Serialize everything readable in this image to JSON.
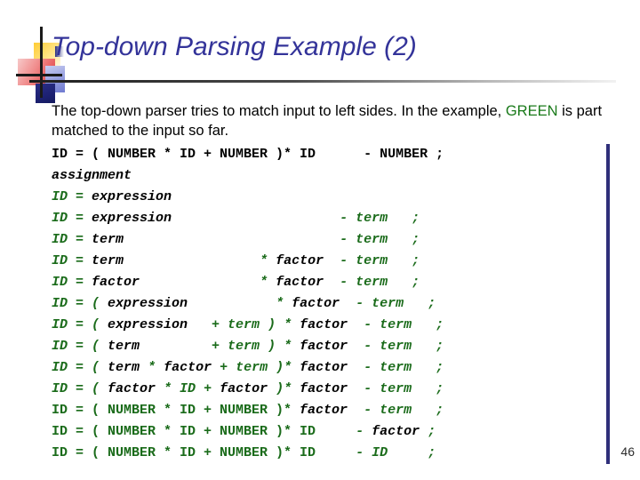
{
  "slide": {
    "title": "Top-down Parsing Example (2)",
    "page_number": "46",
    "accent_color": "#333399",
    "green_color": "#1a6b1a",
    "body": {
      "line1_prefix": "The top-down parser tries to match input to left sides.  In the example, ",
      "green_word": "GREEN",
      "line1_suffix": " is part matched to the input so far."
    }
  },
  "code": {
    "lines": [
      {
        "segments": [
          {
            "text": "ID = ( NUMBER * ID + NUMBER )* ID      ",
            "style": "blk"
          },
          {
            "text": "- NUMBER ;",
            "style": "blk"
          }
        ]
      },
      {
        "segments": [
          {
            "text": "assignment",
            "style": "blki"
          }
        ]
      },
      {
        "segments": [
          {
            "text": "ID = ",
            "style": "grni"
          },
          {
            "text": "expression",
            "style": "blki"
          }
        ]
      },
      {
        "segments": [
          {
            "text": "ID = ",
            "style": "grni"
          },
          {
            "text": "expression",
            "style": "blki"
          },
          {
            "text": "                     ",
            "style": "blki"
          },
          {
            "text": "- term   ;",
            "style": "grni"
          }
        ]
      },
      {
        "segments": [
          {
            "text": "ID = ",
            "style": "grni"
          },
          {
            "text": "term",
            "style": "blki"
          },
          {
            "text": "                           ",
            "style": "blki"
          },
          {
            "text": "- term   ;",
            "style": "grni"
          }
        ]
      },
      {
        "segments": [
          {
            "text": "ID = ",
            "style": "grni"
          },
          {
            "text": "term",
            "style": "blki"
          },
          {
            "text": "                 ",
            "style": "blki"
          },
          {
            "text": "* ",
            "style": "grni"
          },
          {
            "text": "factor",
            "style": "blki"
          },
          {
            "text": "  ",
            "style": "blki"
          },
          {
            "text": "- term   ;",
            "style": "grni"
          }
        ]
      },
      {
        "segments": [
          {
            "text": "ID = ",
            "style": "grni"
          },
          {
            "text": "factor",
            "style": "blki"
          },
          {
            "text": "               ",
            "style": "blki"
          },
          {
            "text": "* ",
            "style": "grni"
          },
          {
            "text": "factor",
            "style": "blki"
          },
          {
            "text": "  ",
            "style": "blki"
          },
          {
            "text": "- term   ;",
            "style": "grni"
          }
        ]
      },
      {
        "segments": [
          {
            "text": "ID = ( ",
            "style": "grni"
          },
          {
            "text": "expression",
            "style": "blki"
          },
          {
            "text": "           ",
            "style": "blki"
          },
          {
            "text": "* ",
            "style": "grni"
          },
          {
            "text": "factor",
            "style": "blki"
          },
          {
            "text": "  ",
            "style": "blki"
          },
          {
            "text": "- term   ;",
            "style": "grni"
          }
        ]
      },
      {
        "segments": [
          {
            "text": "ID = ( ",
            "style": "grni"
          },
          {
            "text": "expression",
            "style": "blki"
          },
          {
            "text": "   ",
            "style": "blki"
          },
          {
            "text": "+ term ) ",
            "style": "grni"
          },
          {
            "text": "* ",
            "style": "grni"
          },
          {
            "text": "factor",
            "style": "blki"
          },
          {
            "text": "  ",
            "style": "blki"
          },
          {
            "text": "- term   ;",
            "style": "grni"
          }
        ]
      },
      {
        "segments": [
          {
            "text": "ID = ( ",
            "style": "grni"
          },
          {
            "text": "term",
            "style": "blki"
          },
          {
            "text": "         ",
            "style": "blki"
          },
          {
            "text": "+ term ) ",
            "style": "grni"
          },
          {
            "text": "* ",
            "style": "grni"
          },
          {
            "text": "factor",
            "style": "blki"
          },
          {
            "text": "  ",
            "style": "blki"
          },
          {
            "text": "- term   ;",
            "style": "grni"
          }
        ]
      },
      {
        "segments": [
          {
            "text": "ID = ( ",
            "style": "grni"
          },
          {
            "text": "term",
            "style": "blki"
          },
          {
            "text": " ",
            "style": "blki"
          },
          {
            "text": "* ",
            "style": "grni"
          },
          {
            "text": "factor",
            "style": "blki"
          },
          {
            "text": " ",
            "style": "blki"
          },
          {
            "text": "+ term )",
            "style": "grni"
          },
          {
            "text": "* ",
            "style": "grni"
          },
          {
            "text": "factor",
            "style": "blki"
          },
          {
            "text": "  ",
            "style": "blki"
          },
          {
            "text": "- term   ;",
            "style": "grni"
          }
        ]
      },
      {
        "segments": [
          {
            "text": "ID = ( ",
            "style": "grni"
          },
          {
            "text": "factor",
            "style": "blki"
          },
          {
            "text": " ",
            "style": "blki"
          },
          {
            "text": "* ID ",
            "style": "grni"
          },
          {
            "text": "+ ",
            "style": "grni"
          },
          {
            "text": "factor",
            "style": "blki"
          },
          {
            "text": " ",
            "style": "blki"
          },
          {
            "text": ")",
            "style": "grni"
          },
          {
            "text": "* ",
            "style": "grni"
          },
          {
            "text": "factor",
            "style": "blki"
          },
          {
            "text": "  ",
            "style": "blki"
          },
          {
            "text": "- term   ;",
            "style": "grni"
          }
        ]
      },
      {
        "segments": [
          {
            "text": "ID = ( NUMBER * ID + NUMBER )* ",
            "style": "grn"
          },
          {
            "text": "factor",
            "style": "blki"
          },
          {
            "text": "  ",
            "style": "blki"
          },
          {
            "text": "- term   ;",
            "style": "grni"
          }
        ]
      },
      {
        "segments": [
          {
            "text": "ID = ( NUMBER * ID + NUMBER )* ID",
            "style": "grn"
          },
          {
            "text": "     ",
            "style": "grn"
          },
          {
            "text": "- ",
            "style": "grni"
          },
          {
            "text": "factor",
            "style": "blki"
          },
          {
            "text": " ;",
            "style": "grni"
          }
        ]
      },
      {
        "segments": [
          {
            "text": "ID = ( NUMBER * ID + NUMBER )* ID",
            "style": "grn"
          },
          {
            "text": "     ",
            "style": "grn"
          },
          {
            "text": "- ID",
            "style": "grni"
          },
          {
            "text": "     ;",
            "style": "grni"
          }
        ]
      }
    ]
  }
}
